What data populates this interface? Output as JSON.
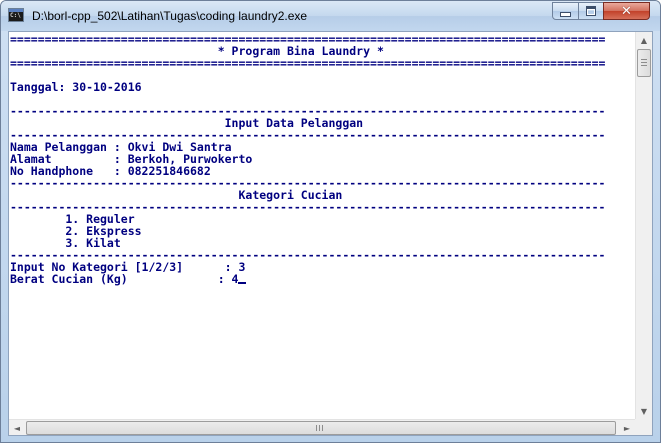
{
  "window": {
    "title": "D:\\borl-cpp_502\\Latihan\\Tugas\\coding laundry2.exe"
  },
  "controls": {
    "minimize_icon": "minimize-icon",
    "maximize_icon": "maximize-icon",
    "close_icon": "close-icon",
    "close_glyph": "✕"
  },
  "console": {
    "lines": [
      "======================================================================================",
      "                              * Program Bina Laundry *",
      "======================================================================================",
      "",
      "Tanggal: 30-10-2016",
      "",
      "--------------------------------------------------------------------------------------",
      "                               Input Data Pelanggan",
      "--------------------------------------------------------------------------------------",
      "Nama Pelanggan : Okvi Dwi Santra",
      "Alamat         : Berkoh, Purwokerto",
      "No Handphone   : 082251846682",
      "--------------------------------------------------------------------------------------",
      "                                 Kategori Cucian",
      "--------------------------------------------------------------------------------------",
      "        1. Reguler",
      "        2. Ekspress",
      "        3. Kilat",
      "--------------------------------------------------------------------------------------",
      "Input No Kategori [1/2/3]      : 3",
      "Berat Cucian (Kg)             : 4"
    ]
  },
  "scrollbars": {
    "up_arrow": "▲",
    "down_arrow": "▼",
    "left_arrow": "◄",
    "right_arrow": "►"
  }
}
